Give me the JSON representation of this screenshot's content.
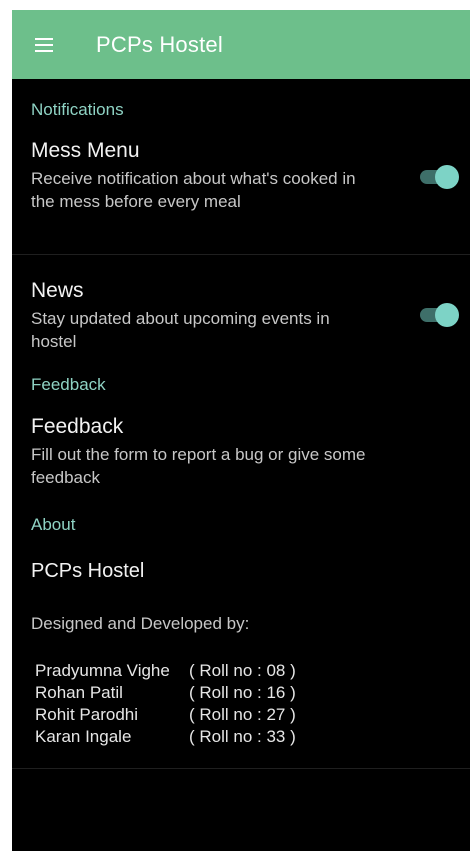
{
  "toolbar": {
    "title": "PCPs Hostel",
    "menu_icon": "hamburger-menu-icon",
    "color": "#6dbf8b"
  },
  "sections": {
    "notifications": {
      "header": "Notifications",
      "mess_menu": {
        "title": "Mess Menu",
        "summary": "Receive notification about what's cooked in the mess before every meal",
        "enabled": true
      },
      "news": {
        "title": "News",
        "summary": "Stay updated about upcoming events in hostel",
        "enabled": true
      }
    },
    "feedback": {
      "header": "Feedback",
      "item": {
        "title": "Feedback",
        "summary": "Fill out the form to report a bug or give some feedback"
      }
    },
    "about": {
      "header": "About",
      "app_name": "PCPs Hostel",
      "designed_by": "Designed and Developed by:",
      "developers": [
        {
          "name": "Pradyumna Vighe",
          "roll": "( Roll no : 08 )"
        },
        {
          "name": "Rohan Patil",
          "roll": "( Roll no : 16 )"
        },
        {
          "name": "Rohit Parodhi",
          "roll": "( Roll no : 27 )"
        },
        {
          "name": "Karan Ingale",
          "roll": "( Roll no : 33 )"
        }
      ]
    }
  },
  "colors": {
    "accent": "#8fd3c4",
    "switch_thumb": "#7dd3c6",
    "background": "#000000"
  }
}
